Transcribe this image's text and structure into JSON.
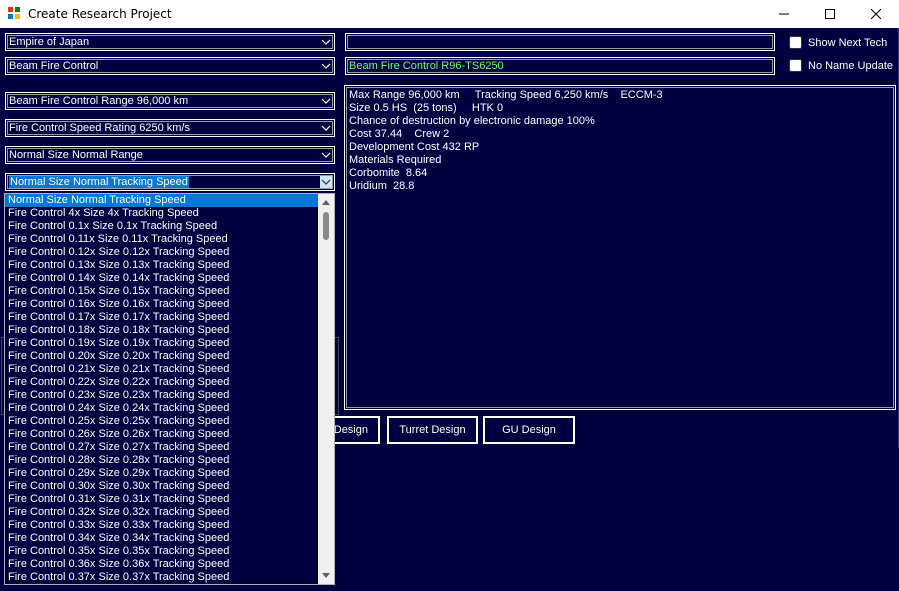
{
  "window": {
    "title": "Create Research Project",
    "icon": "app-icon",
    "controls": [
      "minimize-icon",
      "maximize-icon",
      "close-icon"
    ]
  },
  "selectors": {
    "empire": "Empire of Japan",
    "component_type": "Beam Fire Control",
    "range": "Beam Fire Control Range 96,000 km",
    "speed": "Fire Control Speed Rating 6250 km/s",
    "size": "Normal Size Normal Range",
    "tracking": "Normal Size Normal Tracking Speed"
  },
  "project_name": "",
  "design_name": "Beam Fire Control R96-TS6250",
  "checkboxes": {
    "show_next_tech": {
      "label": "Show Next Tech",
      "checked": false
    },
    "no_name_update": {
      "label": "No Name Update",
      "checked": false
    }
  },
  "info_lines": [
    "Max Range 96,000 km     Tracking Speed 6,250 km/s    ECCM-3",
    "Size 0.5 HS  (25 tons)     HTK 0",
    "Chance of destruction by electronic damage 100%",
    "Cost 37.44    Crew 2",
    "Development Cost 432 RP",
    "",
    "Materials Required",
    "Corbomite  8.64",
    "Uridium  28.8"
  ],
  "buttons": {
    "design": "Design",
    "turret_design": "Turret Design",
    "gu_design": "GU Design"
  },
  "dropdown_options": [
    "Normal Size Normal Tracking Speed",
    "Fire Control 4x Size 4x Tracking Speed",
    "Fire Control 0.1x Size 0.1x Tracking Speed",
    "Fire Control 0.11x Size 0.11x Tracking Speed",
    "Fire Control 0.12x Size 0.12x Tracking Speed",
    "Fire Control 0.13x Size 0.13x Tracking Speed",
    "Fire Control 0.14x Size 0.14x Tracking Speed",
    "Fire Control 0.15x Size 0.15x Tracking Speed",
    "Fire Control 0.16x Size 0.16x Tracking Speed",
    "Fire Control 0.17x Size 0.17x Tracking Speed",
    "Fire Control 0.18x Size 0.18x Tracking Speed",
    "Fire Control 0.19x Size 0.19x Tracking Speed",
    "Fire Control 0.20x Size 0.20x Tracking Speed",
    "Fire Control 0.21x Size 0.21x Tracking Speed",
    "Fire Control 0.22x Size 0.22x Tracking Speed",
    "Fire Control 0.23x Size 0.23x Tracking Speed",
    "Fire Control 0.24x Size 0.24x Tracking Speed",
    "Fire Control 0.25x Size 0.25x Tracking Speed",
    "Fire Control 0.26x Size 0.26x Tracking Speed",
    "Fire Control 0.27x Size 0.27x Tracking Speed",
    "Fire Control 0.28x Size 0.28x Tracking Speed",
    "Fire Control 0.29x Size 0.29x Tracking Speed",
    "Fire Control 0.30x Size 0.30x Tracking Speed",
    "Fire Control 0.31x Size 0.31x Tracking Speed",
    "Fire Control 0.32x Size 0.32x Tracking Speed",
    "Fire Control 0.33x Size 0.33x Tracking Speed",
    "Fire Control 0.34x Size 0.34x Tracking Speed",
    "Fire Control 0.35x Size 0.35x Tracking Speed",
    "Fire Control 0.36x Size 0.36x Tracking Speed",
    "Fire Control 0.37x Size 0.37x Tracking Speed"
  ],
  "dropdown_selected_index": 0,
  "colors": {
    "background": "#000040",
    "selection": "#0078d7",
    "design_name_text": "#6cff6c",
    "border": "#ffffff"
  }
}
